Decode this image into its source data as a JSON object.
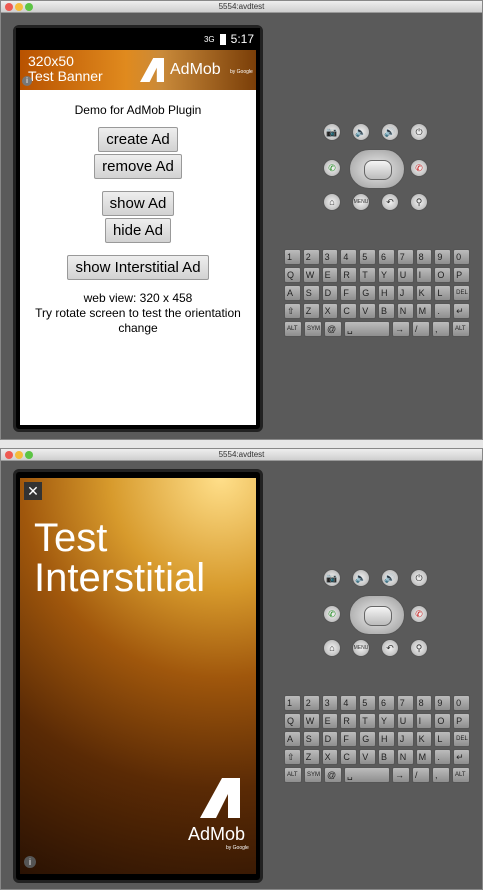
{
  "window_title": "5554:avdtest",
  "status": {
    "signal": "3G",
    "time": "5:17"
  },
  "banner": {
    "size": "320x50",
    "label": "Test Banner",
    "brand": "AdMob",
    "by": "by Google"
  },
  "app": {
    "heading": "Demo for AdMob Plugin",
    "buttons": [
      "create Ad",
      "remove Ad",
      "show Ad",
      "hide Ad",
      "show Interstitial Ad"
    ],
    "web_view": "web view: 320 x 458",
    "hint": "Try rotate screen to test the orientation change"
  },
  "interstitial": {
    "close": "✕",
    "title_line1": "Test",
    "title_line2": "Interstitial",
    "brand": "AdMob",
    "by": "by Google"
  },
  "controls": {
    "camera": "📷",
    "vol_down": "🔈",
    "vol_up": "🔊",
    "power": "⏻",
    "call": "✆",
    "end_call": "✆",
    "home": "⌂",
    "menu": "MENU",
    "back": "↶",
    "search": "⚲"
  },
  "keyboard": {
    "row1": [
      "1",
      "2",
      "3",
      "4",
      "5",
      "6",
      "7",
      "8",
      "9",
      "0"
    ],
    "row2": [
      "Q",
      "W",
      "E",
      "R",
      "T",
      "Y",
      "U",
      "I",
      "O",
      "P"
    ],
    "row3": [
      "A",
      "S",
      "D",
      "F",
      "G",
      "H",
      "J",
      "K",
      "L",
      "DEL"
    ],
    "row4": [
      "⇧",
      "Z",
      "X",
      "C",
      "V",
      "B",
      "N",
      "M",
      ".",
      "↵"
    ],
    "row5": [
      "ALT",
      "SYM",
      "@",
      "␣",
      "→",
      "/",
      ",",
      "ALT"
    ]
  }
}
